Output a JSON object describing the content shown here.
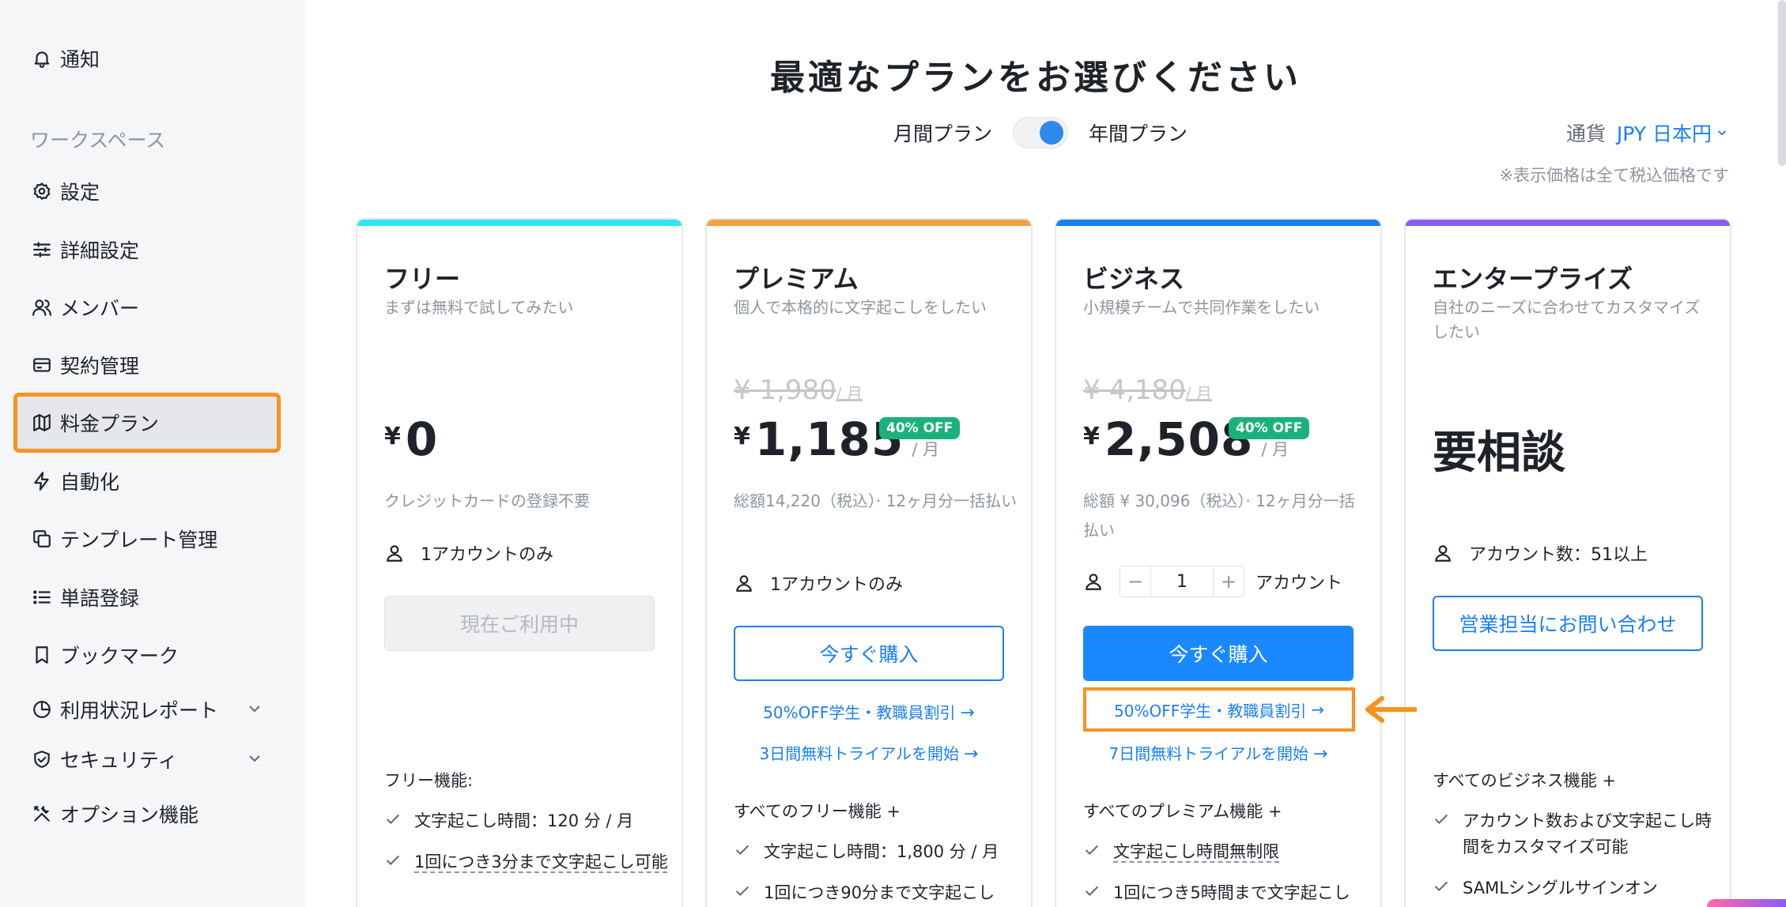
{
  "sidebar": {
    "top_item": "通知",
    "section_label": "ワークスペース",
    "items": [
      {
        "label": "設定"
      },
      {
        "label": "詳細設定"
      },
      {
        "label": "メンバー"
      },
      {
        "label": "契約管理"
      },
      {
        "label": "料金プラン"
      },
      {
        "label": "自動化"
      },
      {
        "label": "テンプレート管理"
      },
      {
        "label": "単語登録"
      },
      {
        "label": "ブックマーク"
      },
      {
        "label": "利用状況レポート"
      },
      {
        "label": "セキュリティ"
      },
      {
        "label": "オプション機能"
      }
    ],
    "active_item": "料金プラン"
  },
  "header": {
    "title": "最適なプランをお選びください",
    "monthly_label": "月間プラン",
    "yearly_label": "年間プラン",
    "billing_selected": "年間プラン",
    "currency_label": "通貨",
    "currency_value": "JPY 日本円",
    "tax_note": "※表示価格は全て税込価格です"
  },
  "plans": [
    {
      "name": "フリー",
      "description": "まずは無料で試してみたい",
      "yen": "¥",
      "price": "0",
      "note": "クレジットカードの登録不要",
      "account": "1アカウントのみ",
      "button": "現在ご利用中",
      "features_head": "フリー機能:",
      "features": [
        "文字起こし時間：120 分 / 月",
        "1回につき3分まで文字起こし可能"
      ],
      "accent": "#2ee6f5"
    },
    {
      "name": "プレミアム",
      "description": "個人で本格的に文字起こしをしたい",
      "old_price": "¥ 1,980",
      "old_unit": "/ 月",
      "yen": "¥",
      "price": "1,185",
      "unit": "/ 月",
      "badge": "40% OFF",
      "note": "総額14,220（税込）· 12ヶ月分一括払い",
      "account": "1アカウントのみ",
      "button": "今すぐ購入",
      "discount_link": "50%OFF学生・教職員割引",
      "trial_link": "3日間無料トライアルを開始",
      "features_head": "すべてのフリー機能 +",
      "features": [
        "文字起こし時間：1,800 分 / 月",
        "1回につき90分まで文字起こし"
      ],
      "accent": "#f5a043"
    },
    {
      "name": "ビジネス",
      "description": "小規模チームで共同作業をしたい",
      "old_price": "¥ 4,180",
      "old_unit": "/ 月",
      "yen": "¥",
      "price": "2,508",
      "unit": "/ 月",
      "badge": "40% OFF",
      "note": "総額 ¥ 30,096（税込）· 12ヶ月分一括払い",
      "stepper_minus": "−",
      "stepper_value": "1",
      "stepper_plus": "+",
      "account": "アカウント",
      "button": "今すぐ購入",
      "discount_link": "50%OFF学生・教職員割引",
      "trial_link": "7日間無料トライアルを開始",
      "features_head": "すべてのプレミアム機能 +",
      "features": [
        "文字起こし時間無制限",
        "1回につき5時間まで文字起こし"
      ],
      "accent": "#1a7ff5"
    },
    {
      "name": "エンタープライズ",
      "description": "自社のニーズに合わせてカスタマイズしたい",
      "price": "要相談",
      "account": "アカウント数：51以上",
      "button": "営業担当にお問い合わせ",
      "features_head": "すべてのビジネス機能 +",
      "features": [
        "アカウント数および文字起こし時間をカスタマイズ可能",
        "SAMLシングルサインオン"
      ],
      "accent": "#8a5cf6"
    }
  ],
  "link_arrow": "→"
}
